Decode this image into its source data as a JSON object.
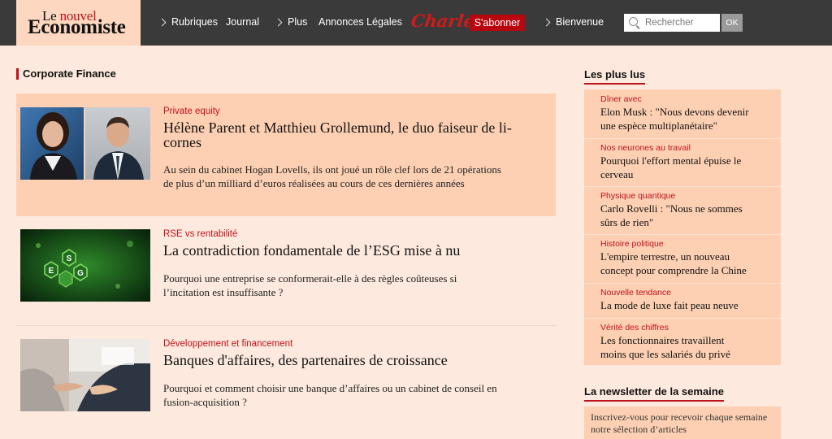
{
  "header": {
    "logo": {
      "line1_le": "Le",
      "line1_rest": " nouvel",
      "line2": "Economiste"
    },
    "nav": [
      {
        "label": "Rubriques",
        "chevron": true
      },
      {
        "label": "Journal",
        "chevron": false
      },
      {
        "label": "Plus",
        "chevron": true
      },
      {
        "label": "Annonces Légales",
        "chevron": false
      },
      {
        "label": "Bienvenue",
        "chevron": true
      }
    ],
    "charles": "Charles",
    "subscribe": "S'abonner",
    "search": {
      "placeholder": "Rechercher",
      "button": "OK"
    }
  },
  "main": {
    "section": "Corporate Finance",
    "articles": [
      {
        "kicker": "Private equity",
        "title": "Hélène Parent et Matthieu Grollemund, le duo faiseur de licornes",
        "title_lines": [
          "Hélène Parent et Matthieu Grollemund, le duo faiseur de li-",
          "cornes"
        ],
        "desc_lines": [
          "Au sein du cabinet Hogan Lovells, ils ont joué un rôle clef lors de 21 opérations",
          "de plus d’un milliard d’euros réalisées au cours de ces dernières années"
        ],
        "highlight": true
      },
      {
        "kicker": "RSE vs rentabilité",
        "title_lines": [
          "La contradiction fondamentale de l’ESG mise à nu"
        ],
        "desc_lines": [
          "Pourquoi une entreprise se conformerait-elle à des règles coûteuses si",
          "l’incitation est insuffisante ?"
        ],
        "image_letters": [
          "E",
          "S",
          "G"
        ]
      },
      {
        "kicker": "Développement et financement",
        "title_lines": [
          "Banques d'affaires, des partenaires de croissance"
        ],
        "desc_lines": [
          "Pourquoi et comment choisir une banque d’affaires ou un cabinet de conseil en",
          "fusion-acquisition ?"
        ]
      }
    ]
  },
  "sidebar": {
    "title": "Les plus lus",
    "items": [
      {
        "kicker": "Dîner avec",
        "lines": [
          "Elon Musk : \"Nous devons devenir",
          "une espèce multiplanétaire\""
        ]
      },
      {
        "kicker": "Nos neurones au travail",
        "lines": [
          "Pourquoi l'effort mental épuise le",
          "cerveau"
        ]
      },
      {
        "kicker": "Physique quantique",
        "lines": [
          "Carlo Rovelli : \"Nous ne sommes",
          "sûrs de rien\""
        ]
      },
      {
        "kicker": "Histoire politique",
        "lines": [
          "L'empire terrestre, un nouveau",
          "concept pour comprendre la Chine"
        ]
      },
      {
        "kicker": "Nouvelle tendance",
        "lines": [
          "La mode de luxe fait peau neuve"
        ]
      },
      {
        "kicker": "Vérité des chiffres",
        "lines": [
          "Les fonctionnaires travaillent",
          "moins que les salariés du privé"
        ]
      }
    ],
    "newsletter": {
      "title": "La newsletter de la semaine",
      "text": "Inscrivez-vous pour recevoir chaque semaine notre sélection d’articles"
    }
  },
  "colors": {
    "accent": "#c0121c",
    "topbar": "#3a3a3a",
    "page_bg": "#fde9dd",
    "card_bg": "#fdd0b3"
  }
}
